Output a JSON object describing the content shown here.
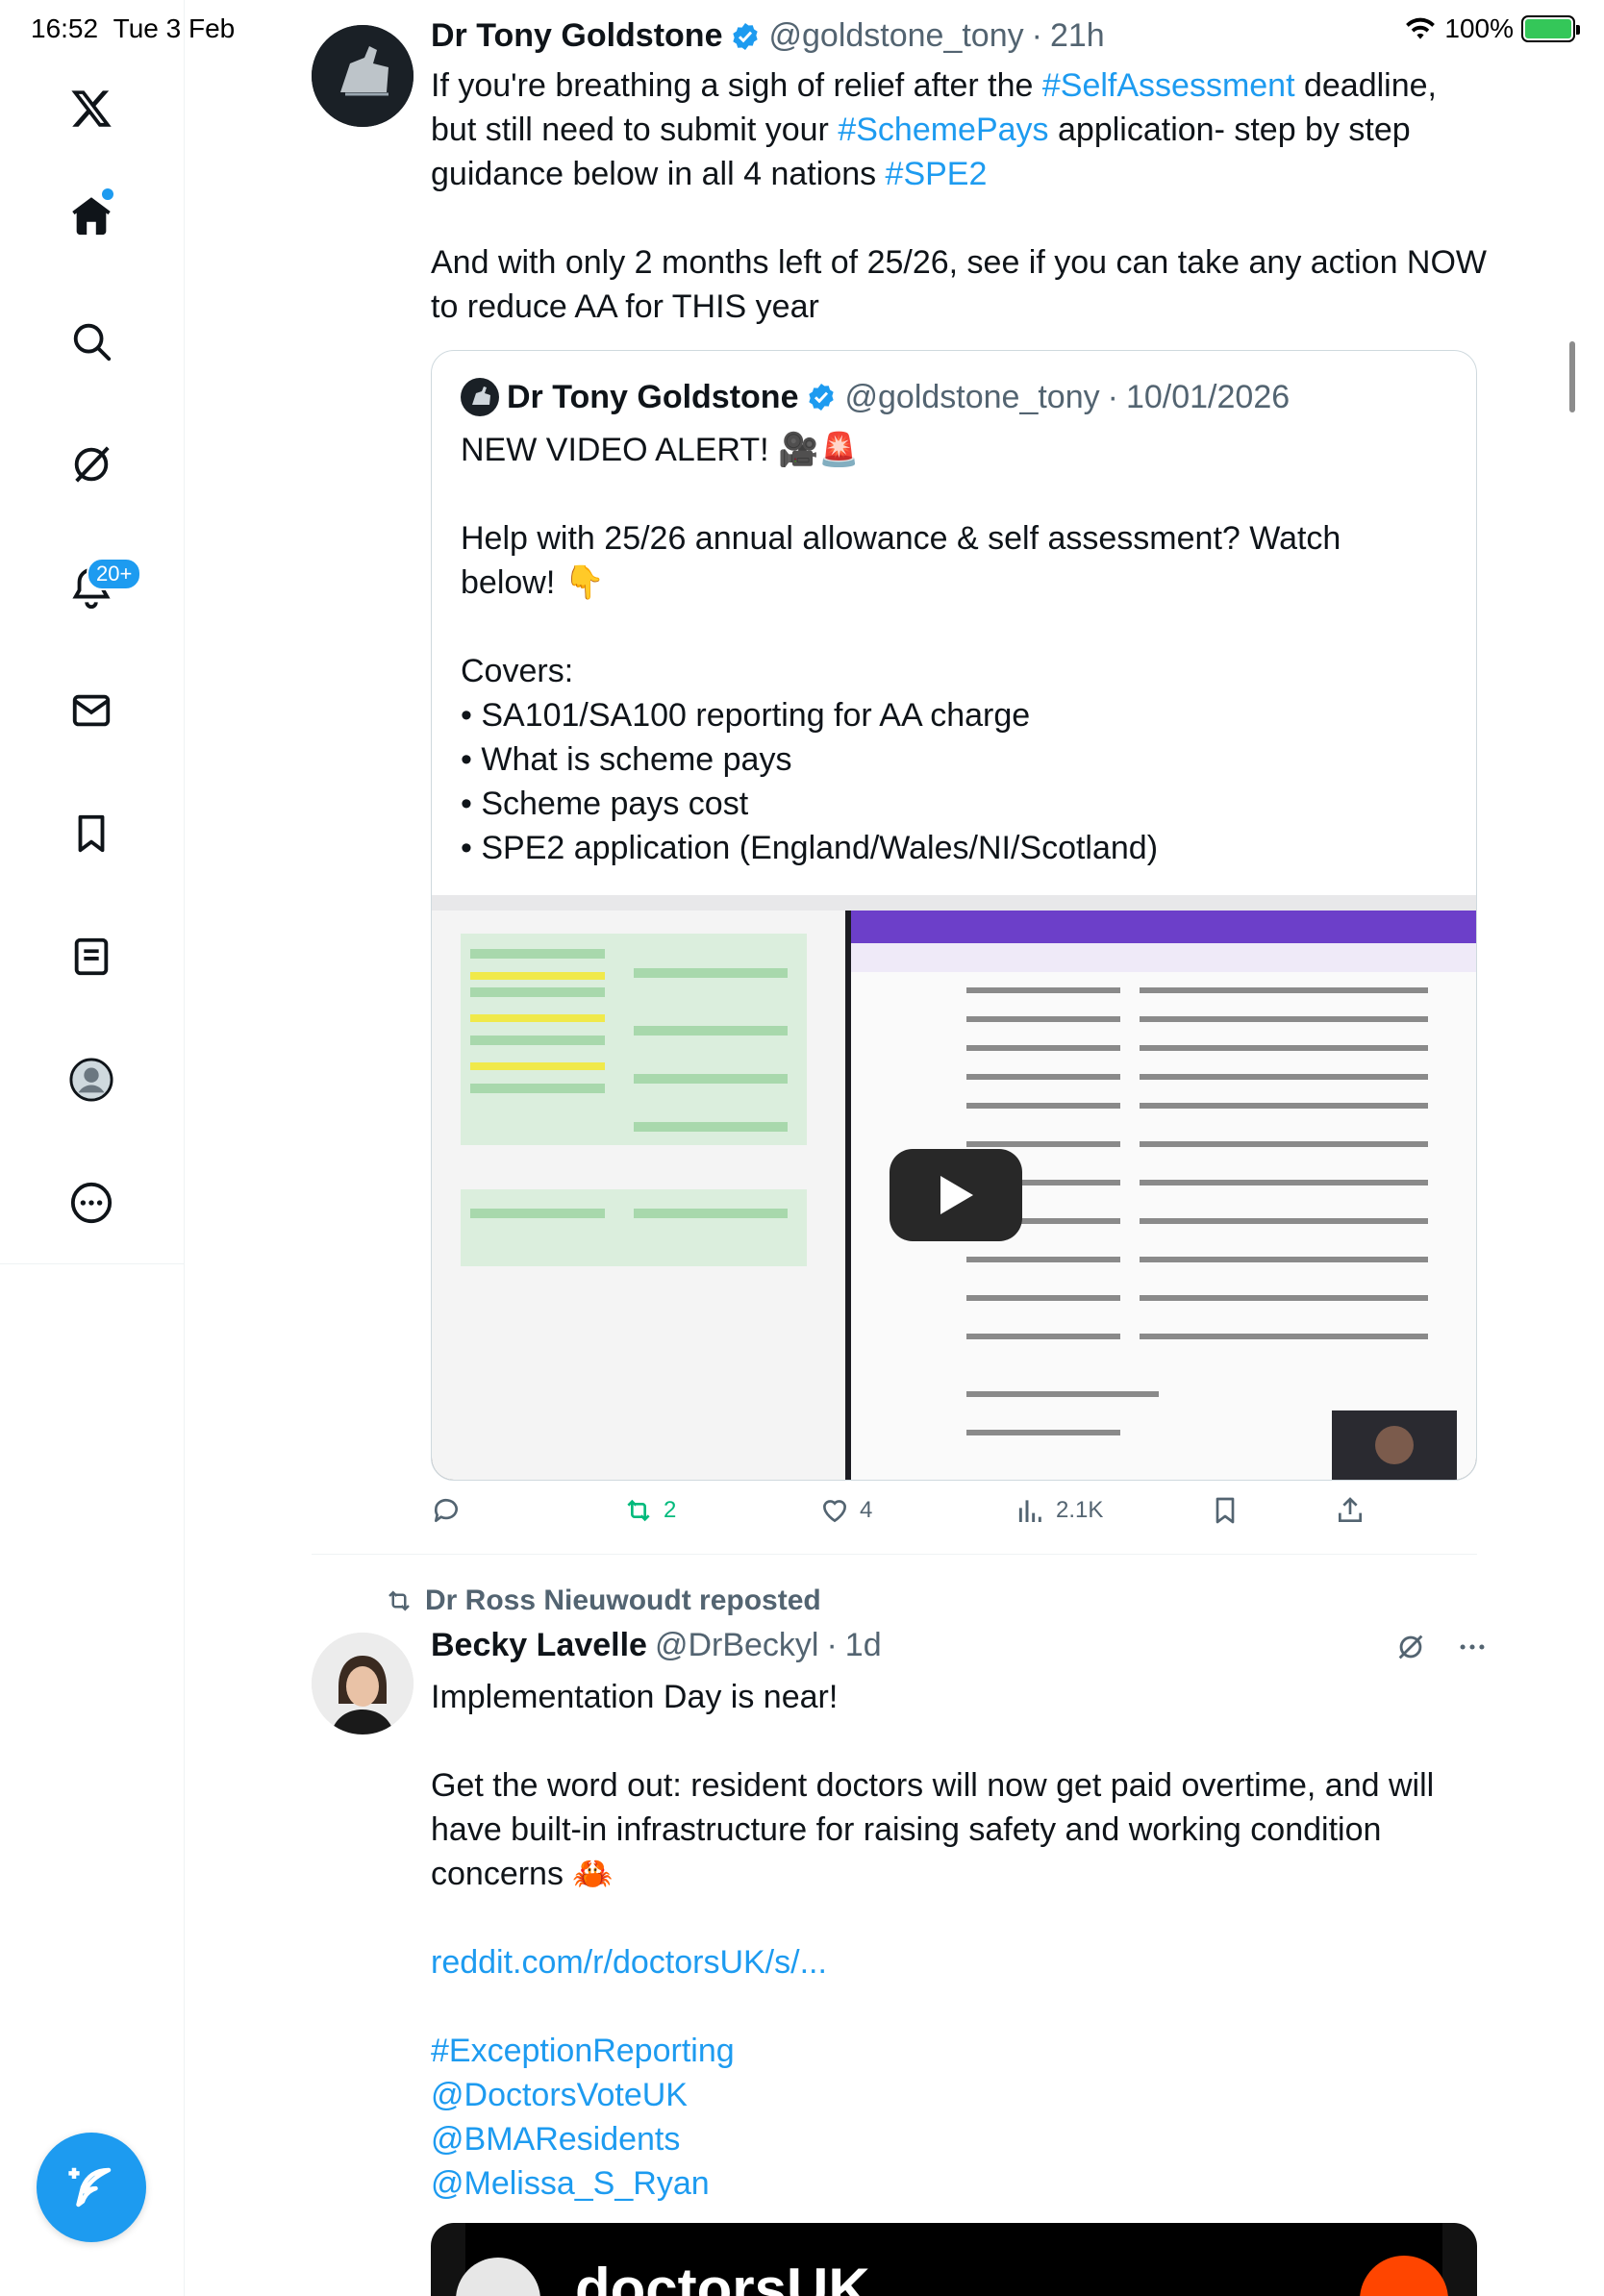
{
  "status_bar": {
    "time": "16:52",
    "date": "Tue 3 Feb",
    "battery": "100%"
  },
  "sidebar": {
    "notification_badge": "20+",
    "items": [
      "x-logo",
      "home",
      "search",
      "grok",
      "notifications",
      "messages",
      "bookmarks",
      "lists",
      "profile",
      "more"
    ]
  },
  "tweet1": {
    "name": "Dr Tony Goldstone",
    "handle": "@goldstone_tony",
    "time": "21h",
    "text_line1_a": "If you're breathing a sigh of relief after the ",
    "tag_self_assessment": "#SelfAssessment",
    "text_line1_b": " deadline,",
    "text_line2_a": "but still need to submit your ",
    "tag_scheme_pays": "#SchemePays",
    "text_line2_b": " application- step by step",
    "text_line3_a": "guidance below in all 4 nations ",
    "tag_spe2": "#SPE2",
    "text_para2": "And with only 2 months left of 25/26, see if you can take any action NOW to reduce AA for THIS year",
    "quote": {
      "name": "Dr Tony Goldstone",
      "handle": "@goldstone_tony",
      "date": "10/01/2026",
      "line1": "NEW VIDEO ALERT! 🎥🚨",
      "line2": "Help with 25/26 annual allowance & self assessment? Watch below! 👇",
      "covers": "Covers:",
      "bullets": [
        "• SA101/SA100 reporting for AA charge",
        "• What is scheme pays",
        "• Scheme pays cost",
        "• SPE2 application (England/Wales/NI/Scotland)"
      ]
    },
    "actions": {
      "replies": "",
      "reposts": "2",
      "likes": "4",
      "views": "2.1K"
    }
  },
  "tweet2": {
    "reposted_by": "Dr Ross Nieuwoudt reposted",
    "name": "Becky Lavelle",
    "handle": "@DrBeckyl",
    "time": "1d",
    "line1": "Implementation Day is near!",
    "para2": "Get the word out: resident doctors will now get paid overtime, and will have built-in infrastructure for raising safety and working condition concerns 🦀",
    "link": "reddit.com/r/doctorsUK/s/...",
    "tags": [
      "#ExceptionReporting",
      "@DoctorsVoteUK",
      "@BMAResidents",
      "@Melissa_S_Ryan"
    ],
    "card_title": "doctorsUK"
  },
  "colors": {
    "accent": "#1d9bf0",
    "repost_green": "#00ba7c",
    "text": "#0f1419",
    "muted": "#536471"
  }
}
